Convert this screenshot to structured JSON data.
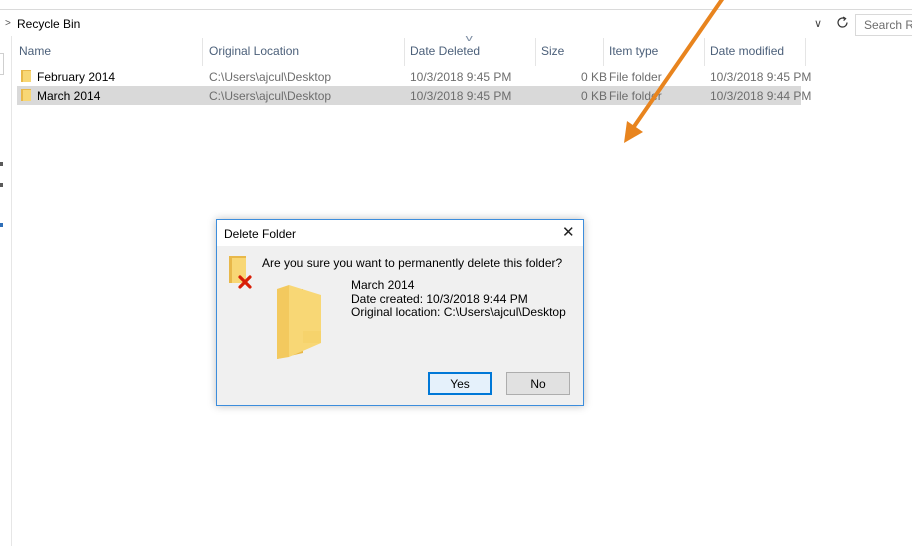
{
  "address_bar": {
    "chevron": ">",
    "location": "Recycle Bin",
    "dropdown_glyph": "∨",
    "refresh_icon": "refresh-icon",
    "search_placeholder": "Search Recy"
  },
  "columns": {
    "name": "Name",
    "original_location": "Original Location",
    "date_deleted": "Date Deleted",
    "size": "Size",
    "item_type": "Item type",
    "date_modified": "Date modified"
  },
  "rows": [
    {
      "name": "February 2014",
      "original_location": "C:\\Users\\ajcul\\Desktop",
      "date_deleted": "10/3/2018 9:45 PM",
      "size": "0 KB",
      "item_type": "File folder",
      "date_modified": "10/3/2018 9:45 PM",
      "selected": false
    },
    {
      "name": "March 2014",
      "original_location": "C:\\Users\\ajcul\\Desktop",
      "date_deleted": "10/3/2018 9:45 PM",
      "size": "0 KB",
      "item_type": "File folder",
      "date_modified": "10/3/2018 9:44 PM",
      "selected": true
    }
  ],
  "dialog": {
    "title": "Delete Folder",
    "close_glyph": "✕",
    "question": "Are you sure you want to permanently delete this folder?",
    "item_name": "March 2014",
    "date_created": "Date created: 10/3/2018 9:44 PM",
    "original_location": "Original location: C:\\Users\\ajcul\\Desktop",
    "yes_label": "Yes",
    "no_label": "No"
  },
  "colors": {
    "accent": "#0078d7",
    "folder": "#f8d775",
    "folder_dark": "#e8b84a",
    "arrow": "#e8841e",
    "delete_x": "#d81e06",
    "selected_row": "#d9d9d9"
  }
}
